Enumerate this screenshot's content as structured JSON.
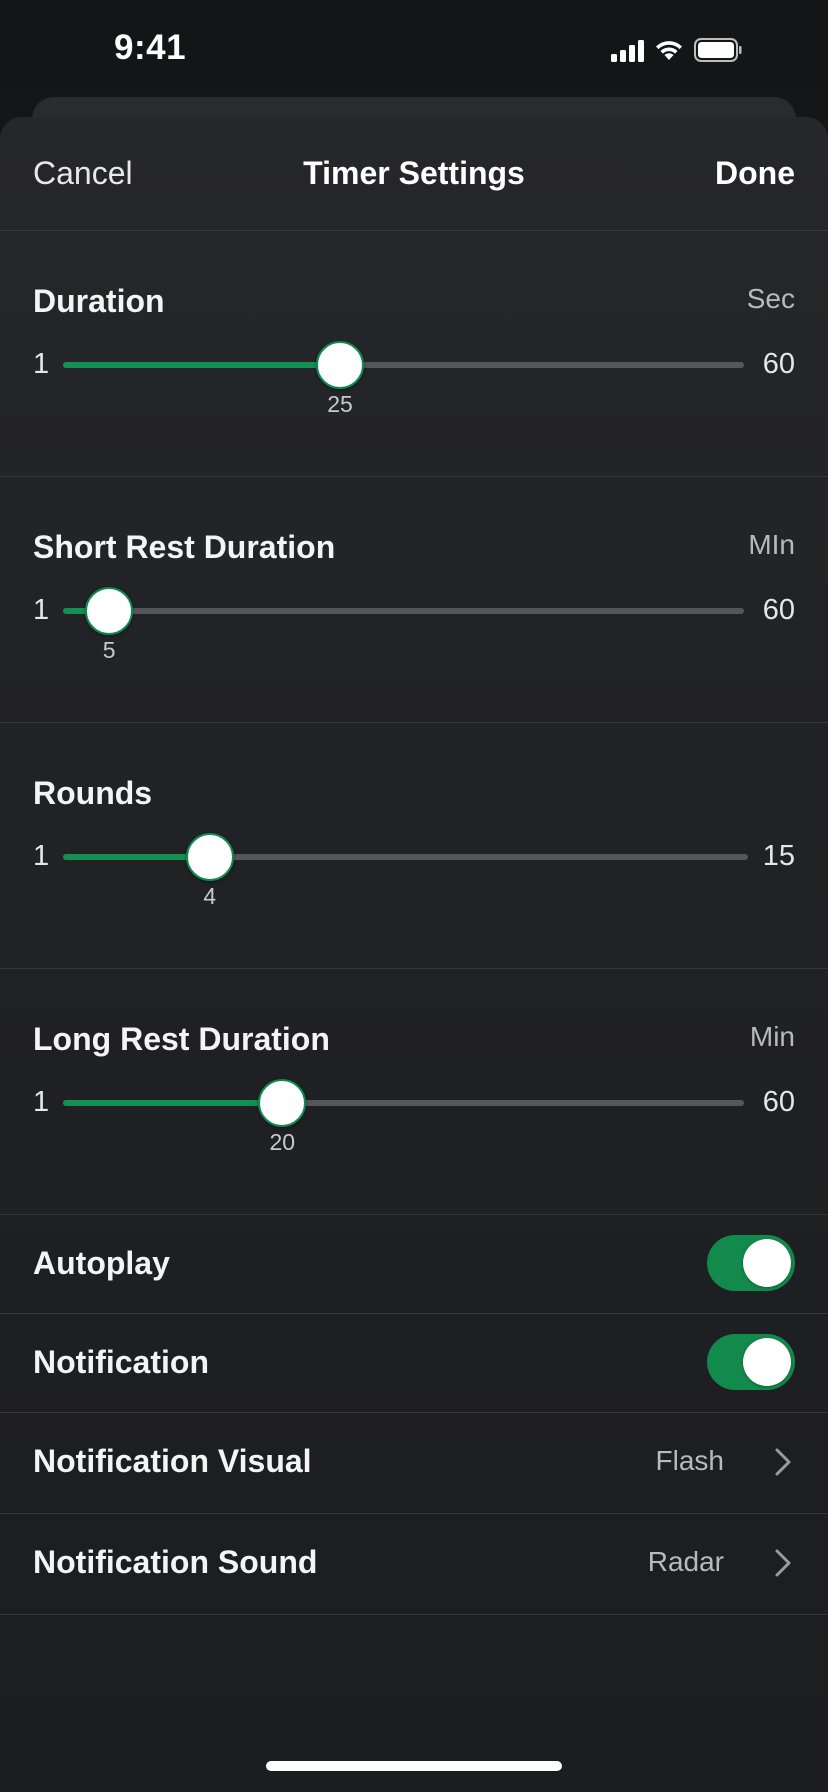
{
  "status_bar": {
    "time": "9:41"
  },
  "nav": {
    "cancel_label": "Cancel",
    "title": "Timer Settings",
    "done_label": "Done"
  },
  "sliders": [
    {
      "title": "Duration",
      "unit": "Sec",
      "min": "1",
      "max": "60",
      "value": "25",
      "min_value": 1,
      "max_value": 60,
      "current_value": 25
    },
    {
      "title": "Short Rest Duration",
      "unit": "MIn",
      "min": "1",
      "max": "60",
      "value": "5",
      "min_value": 1,
      "max_value": 60,
      "current_value": 5
    },
    {
      "title": "Rounds",
      "unit": "",
      "min": "1",
      "max": "15",
      "value": "4",
      "min_value": 1,
      "max_value": 15,
      "current_value": 4
    },
    {
      "title": "Long Rest Duration",
      "unit": "Min",
      "min": "1",
      "max": "60",
      "value": "20",
      "min_value": 1,
      "max_value": 60,
      "current_value": 20
    }
  ],
  "toggles": [
    {
      "label": "Autoplay",
      "on": true
    },
    {
      "label": "Notification",
      "on": true
    }
  ],
  "links": [
    {
      "label": "Notification Visual",
      "value": "Flash"
    },
    {
      "label": "Notification Sound",
      "value": "Radar"
    }
  ],
  "colors": {
    "accent": "#139052",
    "toggle_on": "#128a4c",
    "background": "#1e1f22"
  }
}
